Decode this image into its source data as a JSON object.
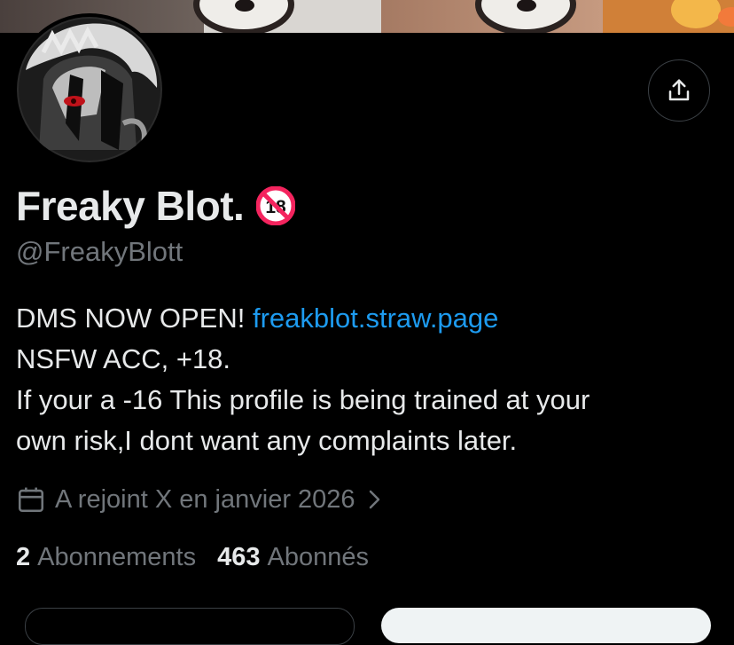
{
  "profile": {
    "display_name": "Freaky Blot.",
    "badge_icon": "no-under-18-icon",
    "handle": "@FreakyBlott",
    "bio": {
      "line1_text": "DMS NOW OPEN! ",
      "line1_link": "freakblot.straw.page",
      "line2": "NSFW ACC, +18.",
      "line3": "If your a -16 This profile is being trained at your",
      "line4": "own risk,I dont want any complaints later."
    },
    "joined": "A rejoint X en janvier 2026",
    "following_count": "2",
    "following_label": "Abonnements",
    "followers_count": "463",
    "followers_label": "Abonnés"
  },
  "colors": {
    "background": "#000000",
    "text": "#e7e9ea",
    "muted": "#71767b",
    "link": "#1d9bf0",
    "badge_red": "#f4245e"
  },
  "icons": {
    "share": "share-icon",
    "calendar": "calendar-icon",
    "chevron": "chevron-right-icon"
  }
}
